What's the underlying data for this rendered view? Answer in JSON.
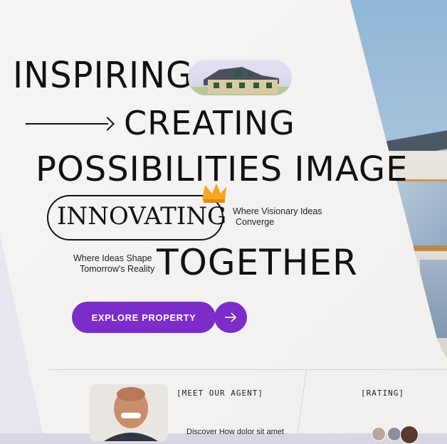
{
  "hero": {
    "line1": "INSPIRING",
    "line2": "CREATING",
    "line3": "POSSIBILITIES IMAGE",
    "pill_word": "INNOVATING",
    "line5": "TOGETHER",
    "tag_right_1": "Where Visionary Ideas",
    "tag_right_2": "Converge",
    "tag_left_1": "Where Ideas Shape",
    "tag_left_2": "Tomorrow's Reality"
  },
  "cta": {
    "label": "EXPLORE PROPERTY"
  },
  "agent": {
    "section_label": "[MEET OUR AGENT]",
    "description": "Discover How dolor sit amet"
  },
  "rating": {
    "section_label": "[RATING]"
  },
  "colors": {
    "accent": "#7b2cc9",
    "crown": "#f5a623"
  },
  "icons": {
    "arrow": "right-arrow-icon",
    "crown": "crown-icon"
  }
}
